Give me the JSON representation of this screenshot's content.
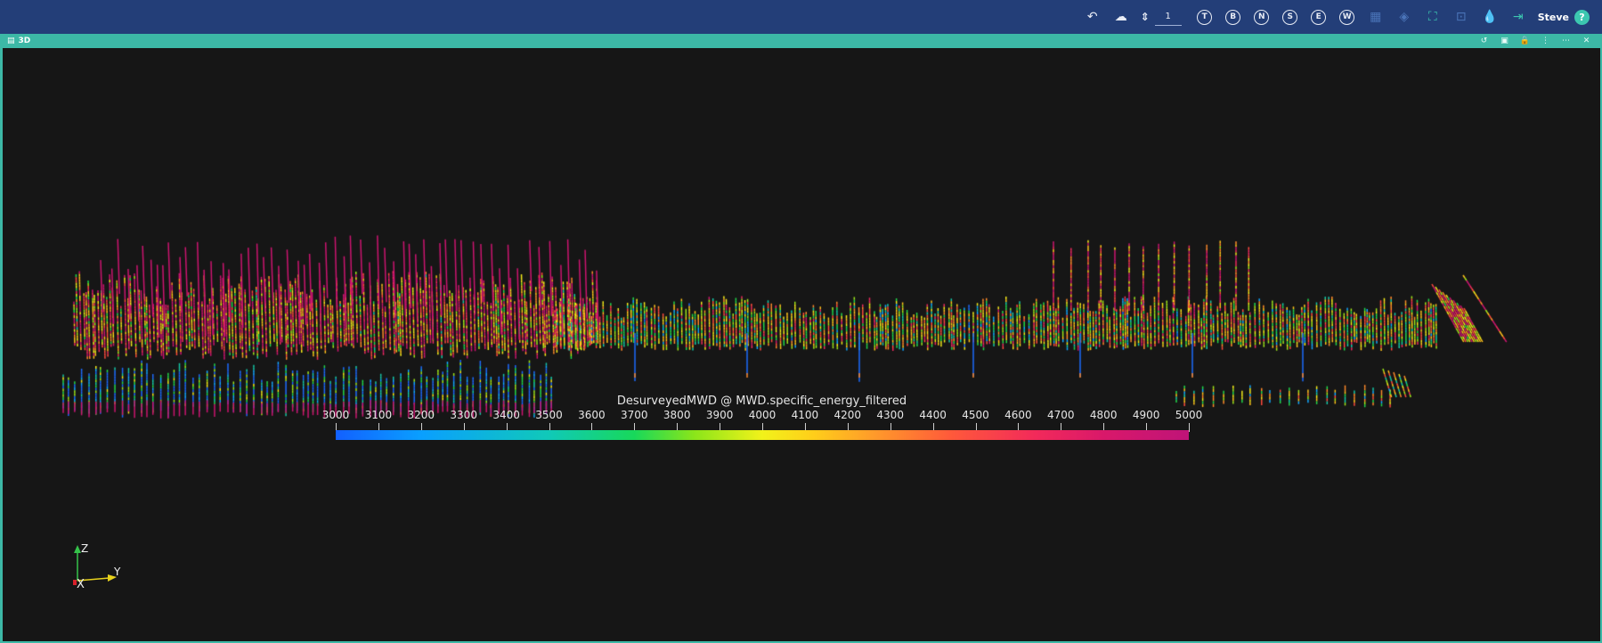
{
  "toolbar": {
    "level_value": "1",
    "buttons": [
      {
        "name": "undo-icon",
        "glyph": "↶"
      },
      {
        "name": "cloud-icon",
        "glyph": "☁"
      },
      {
        "name": "level-icon",
        "glyph": "⇕"
      }
    ],
    "circle_buttons": [
      "T",
      "B",
      "N",
      "S",
      "E",
      "W"
    ],
    "user_name": "Steve",
    "help_label": "?"
  },
  "panel": {
    "title": "3D"
  },
  "legend": {
    "title": "DesurveyedMWD @ MWD.specific_energy_filtered",
    "ticks": [
      "3000",
      "3100",
      "3200",
      "3300",
      "3400",
      "3500",
      "3600",
      "3700",
      "3800",
      "3900",
      "4000",
      "4100",
      "4200",
      "4300",
      "4400",
      "4500",
      "4600",
      "4700",
      "4800",
      "4900",
      "5000"
    ],
    "min": 3000,
    "max": 5000
  },
  "axes": {
    "z_label": "Z",
    "y_label": "Y",
    "x_label": "X"
  },
  "colors": {
    "topbar": "#233e78",
    "panel_header": "#3cb8a6",
    "viewport_bg": "#161616"
  }
}
